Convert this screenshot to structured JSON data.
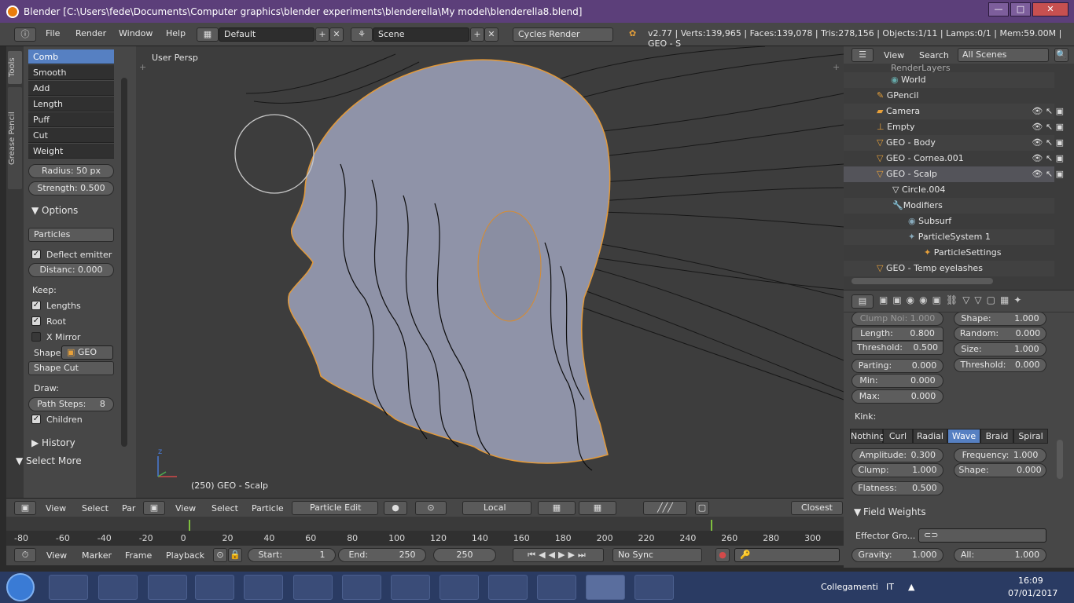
{
  "titlebar": {
    "title": "Blender [C:\\Users\\fede\\Documents\\Computer graphics\\blender experiments\\blenderella\\My model\\blenderella8.blend]",
    "min": "—",
    "max": "□",
    "close": "✕"
  },
  "header": {
    "menus": [
      "File",
      "Render",
      "Window",
      "Help"
    ],
    "layout": "Default",
    "scene": "Scene",
    "engine": "Cycles Render",
    "stats": "v2.77 | Verts:139,965 | Faces:139,078 | Tris:278,156 | Objects:1/11 | Lamps:0/1 | Mem:59.00M | GEO - S"
  },
  "lefttabs": [
    "Tools",
    "Grease Pencil"
  ],
  "tools": {
    "brushes": [
      "Comb",
      "Smooth",
      "Add",
      "Length",
      "Puff",
      "Cut",
      "Weight"
    ],
    "radius": "Radius:    50 px",
    "strength": "Strength: 0.500",
    "options_label": "Options",
    "mode": "Particles",
    "deflect": "Deflect emitter",
    "distance": "Distanc:  0.000",
    "keep_label": "Keep:",
    "lengths": "Lengths",
    "root": "Root",
    "xmirror": "X Mirror",
    "shape_label": "Shape",
    "shape_value": "GEO",
    "shape_cut": "Shape Cut",
    "draw_label": "Draw:",
    "path_steps": "Path Steps:",
    "path_steps_value": "8",
    "children": "Children",
    "history": "History",
    "select_more": "Select More"
  },
  "viewport": {
    "label": "User Persp",
    "status": "(250) GEO - Scalp",
    "axis_z": "z"
  },
  "vp_header": {
    "view": "View",
    "select": "Select",
    "particle": "Particle",
    "par": "Par",
    "mode": "Particle Edit",
    "orientation": "Local",
    "snap": "Closest"
  },
  "outliner": {
    "view": "View",
    "search": "Search",
    "scenes": "All Scenes",
    "rows": [
      "RenderLayers",
      "World",
      "GPencil",
      "Camera",
      "Empty",
      "GEO - Body",
      "GEO - Cornea.001",
      "GEO - Scalp",
      "Circle.004",
      "Modifiers",
      "Subsurf",
      "ParticleSystem 1",
      "ParticleSettings",
      "GEO - Temp eyelashes"
    ]
  },
  "props": {
    "clump_noise": "Clump Noi: 1.000",
    "shape_top": "Shape:",
    "shape_top_v": "1.000",
    "length": "Length:",
    "length_v": "0.800",
    "threshold": "Threshold:",
    "threshold_v": "0.500",
    "random": "Random:",
    "random_v": "0.000",
    "size": "Size:",
    "size_v": "1.000",
    "threshold2": "Threshold:",
    "threshold2_v": "0.000",
    "parting": "Parting:",
    "parting_v": "0.000",
    "min": "Min:",
    "min_v": "0.000",
    "max": "Max:",
    "max_v": "0.000",
    "kink": "Kink:",
    "kink_tabs": [
      "Nothing",
      "Curl",
      "Radial",
      "Wave",
      "Braid",
      "Spiral"
    ],
    "amplitude": "Amplitude:",
    "amplitude_v": "0.300",
    "frequency": "Frequency:",
    "frequency_v": "1.000",
    "clump": "Clump:",
    "clump_v": "1.000",
    "shape2": "Shape:",
    "shape2_v": "0.000",
    "flatness": "Flatness:",
    "flatness_v": "0.500",
    "field_weights": "Field Weights",
    "effector": "Effector Gro...",
    "gravity": "Gravity:",
    "gravity_v": "1.000",
    "all": "All:",
    "all_v": "1.000"
  },
  "timeline": {
    "ticks": [
      "-80",
      "-60",
      "-40",
      "-20",
      "0",
      "20",
      "40",
      "60",
      "80",
      "100",
      "120",
      "140",
      "160",
      "180",
      "200",
      "220",
      "240",
      "260",
      "280",
      "300"
    ],
    "view": "View",
    "marker": "Marker",
    "frame": "Frame",
    "playback": "Playback",
    "start": "Start:",
    "start_v": "1",
    "end": "End:",
    "end_v": "250",
    "current": "250",
    "sync": "No Sync"
  },
  "taskbar": {
    "collegamenti": "Collegamenti",
    "lang": "IT",
    "time": "16:09",
    "date": "07/01/2017"
  }
}
